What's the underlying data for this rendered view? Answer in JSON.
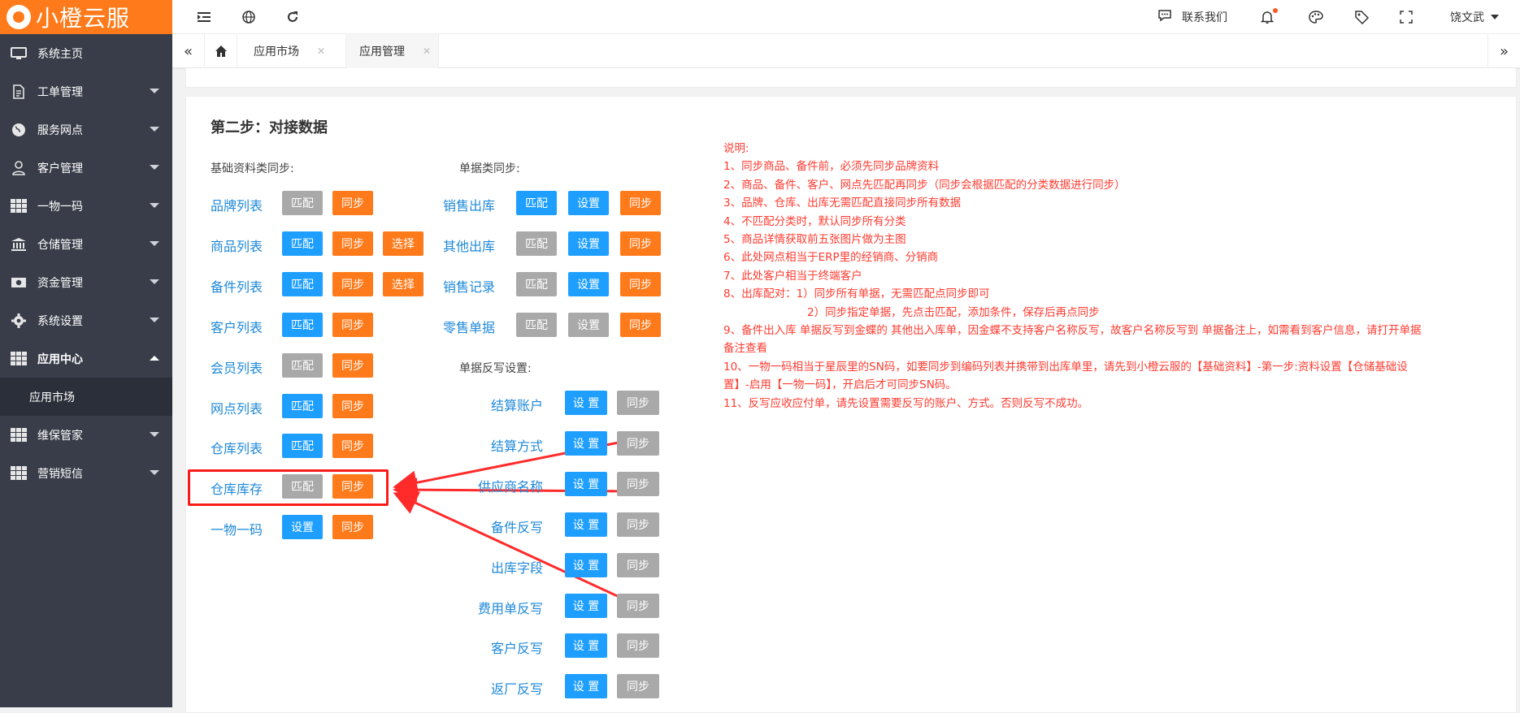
{
  "app": {
    "name": "小橙云服"
  },
  "topbar": {
    "contact": "联系我们",
    "user": "饶文武"
  },
  "sidebar": {
    "items": [
      {
        "label": "系统主页",
        "icon": "monitor-icon"
      },
      {
        "label": "工单管理",
        "icon": "document-icon"
      },
      {
        "label": "服务网点",
        "icon": "globe-icon"
      },
      {
        "label": "客户管理",
        "icon": "user-icon"
      },
      {
        "label": "一物一码",
        "icon": "grid-icon"
      },
      {
        "label": "仓储管理",
        "icon": "bank-icon"
      },
      {
        "label": "资金管理",
        "icon": "money-icon"
      },
      {
        "label": "系统设置",
        "icon": "gear-icon"
      },
      {
        "label": "应用中心",
        "icon": "grid-icon"
      }
    ],
    "submenu": "应用市场",
    "items2": [
      {
        "label": "维保管家",
        "icon": "grid-icon"
      },
      {
        "label": "营销短信",
        "icon": "grid-icon"
      }
    ]
  },
  "tabs": [
    {
      "label": "应用市场"
    },
    {
      "label": "应用管理"
    }
  ],
  "main": {
    "title": "第二步：对接数据",
    "basic_label": "基础资料类同步:",
    "doc_label": "单据类同步:",
    "writeback_label": "单据反写设置:",
    "basic_rows": [
      {
        "name": "品牌列表",
        "buttons": [
          "匹配",
          "同步"
        ]
      },
      {
        "name": "商品列表",
        "buttons": [
          "匹配",
          "同步",
          "选择"
        ]
      },
      {
        "name": "备件列表",
        "buttons": [
          "匹配",
          "同步",
          "选择"
        ]
      },
      {
        "name": "客户列表",
        "buttons": [
          "匹配",
          "同步"
        ]
      },
      {
        "name": "会员列表",
        "buttons": [
          "匹配",
          "同步"
        ]
      },
      {
        "name": "网点列表",
        "buttons": [
          "匹配",
          "同步"
        ]
      },
      {
        "name": "仓库列表",
        "buttons": [
          "匹配",
          "同步"
        ]
      },
      {
        "name": "仓库库存",
        "buttons": [
          "匹配",
          "同步"
        ]
      },
      {
        "name": "一物一码",
        "buttons": [
          "设置",
          "同步"
        ]
      }
    ],
    "doc_rows": [
      {
        "name": "销售出库",
        "buttons": [
          "匹配",
          "设置",
          "同步"
        ]
      },
      {
        "name": "其他出库",
        "buttons": [
          "匹配",
          "设置",
          "同步"
        ]
      },
      {
        "name": "销售记录",
        "buttons": [
          "匹配",
          "设置",
          "同步"
        ]
      },
      {
        "name": "零售单据",
        "buttons": [
          "匹配",
          "设置",
          "同步"
        ]
      }
    ],
    "writeback_rows": [
      {
        "name": "结算账户",
        "buttons": [
          "设 置",
          "同步"
        ]
      },
      {
        "name": "结算方式",
        "buttons": [
          "设 置",
          "同步"
        ]
      },
      {
        "name": "供应商名称",
        "buttons": [
          "设 置",
          "同步"
        ]
      },
      {
        "name": "备件反写",
        "buttons": [
          "设 置",
          "同步"
        ]
      },
      {
        "name": "出库字段",
        "buttons": [
          "设 置",
          "同步"
        ]
      },
      {
        "name": "费用单反写",
        "buttons": [
          "设 置",
          "同步"
        ]
      },
      {
        "name": "客户反写",
        "buttons": [
          "设 置",
          "同步"
        ]
      },
      {
        "name": "返厂反写",
        "buttons": [
          "设 置",
          "同步"
        ]
      }
    ],
    "notes": [
      "说明:",
      "1、同步商品、备件前，必须先同步品牌资料",
      "2、商品、备件、客户、网点先匹配再同步（同步会根据匹配的分类数据进行同步）",
      "3、品牌、仓库、出库无需匹配直接同步所有数据",
      "4、不匹配分类时，默认同步所有分类",
      "5、商品详情获取前五张图片做为主图",
      "6、此处网点相当于ERP里的经销商、分销商",
      "7、此处客户相当于终端客户",
      "8、出库配对：1）同步所有单据，无需匹配点同步即可",
      "                        2）同步指定单据，先点击匹配，添加条件，保存后再点同步",
      "9、备件出入库 单据反写到金蝶的 其他出入库单，因金蝶不支持客户名称反写，故客户名称反写到 单据备注上，如需看到客户信息，请打开单据备注查看",
      "10、一物一码相当于星辰里的SN码，如要同步到编码列表并携带到出库单里，请先到小橙云服的【基础资料】-第一步:资料设置【仓储基础设置】-启用【一物一码】，开启后才可同步SN码。",
      "11、反写应收应付单，请先设置需要反写的账户、方式。否则反写不成功。"
    ]
  },
  "colors": {
    "orange": "#ff7a1a",
    "blue": "#1e9fff",
    "gray": "#a9a9a9",
    "sidebar": "#393d49",
    "note_red": "#ff3b30",
    "link_blue": "#1e88d8"
  }
}
